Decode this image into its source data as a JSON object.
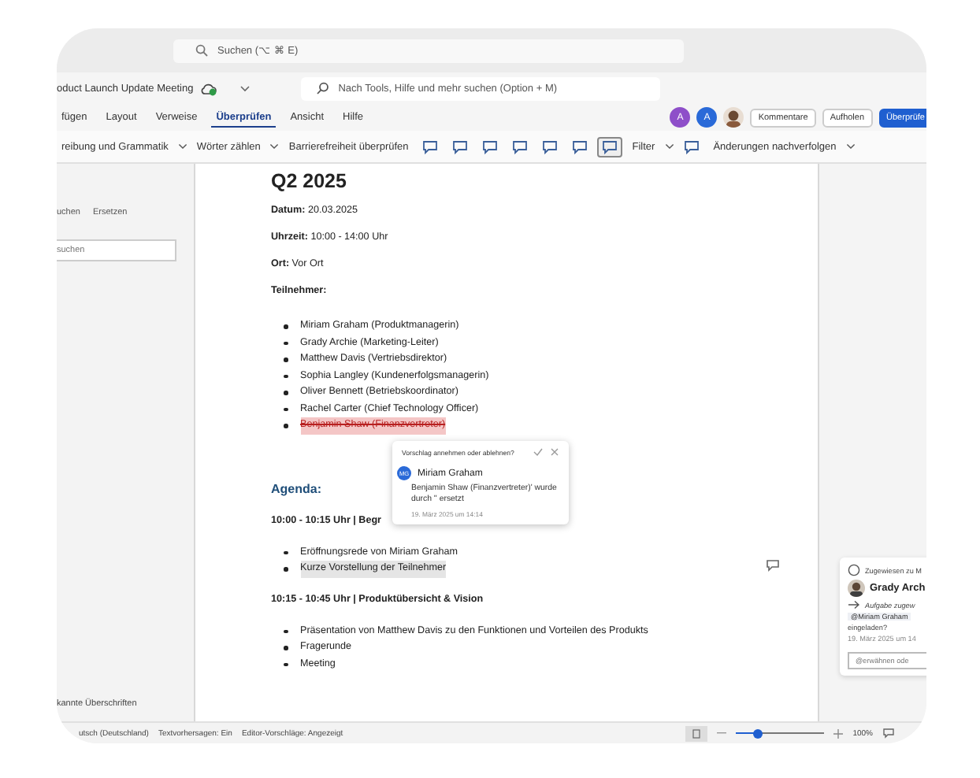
{
  "search": {
    "placeholder": "Suchen (⌥ ⌘ E)"
  },
  "document_title": "oduct Launch Update Meeting",
  "tool_search": {
    "placeholder": "Nach Tools, Hilfe und mehr suchen (Option + M)"
  },
  "tabs": [
    {
      "label": "fügen",
      "selected": false
    },
    {
      "label": "Layout",
      "selected": false
    },
    {
      "label": "Verweise",
      "selected": false
    },
    {
      "label": "Überprüfen",
      "selected": true
    },
    {
      "label": "Ansicht",
      "selected": false
    },
    {
      "label": "Hilfe",
      "selected": false
    }
  ],
  "avatars": [
    {
      "kind": "initials",
      "initials": "A",
      "color": "#8e4fc9"
    },
    {
      "kind": "initials",
      "initials": "A",
      "color": "#2a6ad8"
    },
    {
      "kind": "picture"
    }
  ],
  "header_buttons": [
    {
      "label": "Kommentare",
      "kind": "outline"
    },
    {
      "label": "Aufholen",
      "kind": "outline"
    },
    {
      "label": "Überprüfe",
      "kind": "primary"
    }
  ],
  "toolbar": [
    {
      "kind": "dropdown",
      "label": "reibung und Grammatik"
    },
    {
      "kind": "dropdown",
      "label": "Wörter zählen"
    },
    {
      "kind": "button",
      "label": "Barrierefreiheit überprüfen"
    },
    {
      "kind": "icon",
      "selected": false
    },
    {
      "kind": "icon",
      "selected": false
    },
    {
      "kind": "icon",
      "selected": false
    },
    {
      "kind": "icon",
      "selected": false
    },
    {
      "kind": "icon",
      "selected": false
    },
    {
      "kind": "icon",
      "selected": false
    },
    {
      "kind": "icon",
      "selected": true
    },
    {
      "kind": "dropdown",
      "label": "Filter"
    },
    {
      "kind": "icon",
      "selected": false
    },
    {
      "kind": "dropdown",
      "label": "Änderungen nachverfolgen"
    }
  ],
  "nav_pane": {
    "tabs": [
      "uchen",
      "Ersetzen"
    ],
    "search": {
      "placeholder": "suchen"
    },
    "footer": "kannte Überschriften"
  },
  "document": {
    "heading": "Q2 2025",
    "fields": [
      {
        "label": "Datum:",
        "value": "20.03.2025"
      },
      {
        "label": "Uhrzeit:",
        "value": "10:00 - 14:00 Uhr"
      },
      {
        "label": "Ort:",
        "value": "Vor Ort"
      }
    ],
    "attendees_label": "Teilnehmer:",
    "attendees": [
      {
        "text": "Miriam Graham (Produktmanagerin)",
        "deleted": false
      },
      {
        "text": "Grady Archie (Marketing-Leiter)",
        "deleted": false
      },
      {
        "text": "Matthew Davis (Vertriebsdirektor)",
        "deleted": false
      },
      {
        "text": "Sophia Langley (Kundenerfolgsmanagerin)",
        "deleted": false
      },
      {
        "text": "Oliver Bennett (Betriebskoordinator)",
        "deleted": false
      },
      {
        "text": "Rachel Carter (Chief Technology Officer)",
        "deleted": false
      },
      {
        "text": "Benjamin Shaw (Finanzvertreter)",
        "deleted": true
      }
    ],
    "agenda_heading": "Agenda:",
    "sections": [
      {
        "title": "10:00 - 10:15 Uhr | Begr",
        "items": [
          {
            "text": "Eröffnungsrede von Miriam Graham",
            "highlighted": false
          },
          {
            "text": "Kurze Vorstellung der Teilnehmer",
            "highlighted": true
          }
        ]
      },
      {
        "title": "10:15 - 10:45 Uhr | Produktübersicht & Vision",
        "items": [
          {
            "text": "Präsentation von Matthew Davis zu den Funktionen und Vorteilen des Produkts",
            "highlighted": false
          },
          {
            "text": "Fragerunde",
            "highlighted": false
          },
          {
            "text": "Meeting",
            "highlighted": false
          }
        ]
      }
    ]
  },
  "suggestion_popup": {
    "question": "Vorschlag annehmen oder ablehnen?",
    "author_initials": "MG",
    "author": "Miriam Graham",
    "text": "Benjamin Shaw (Finanzvertreter)' wurde durch '' ersetzt",
    "time": "19. März 2025 um 14:14"
  },
  "comment_card": {
    "assigned": "Zugewiesen zu M",
    "author": "Grady Arch",
    "task": "Aufgabe zugew",
    "mention": "@Miriam Graham",
    "text": "eingeladen?",
    "time": "19. März 2025 um 14",
    "reply": {
      "placeholder": "@erwähnen ode"
    }
  },
  "status_bar": {
    "items": [
      "utsch (Deutschland)",
      "Textvorhersagen: Ein",
      "Editor-Vorschläge: Angezeigt"
    ],
    "zoom": {
      "level": 0.25,
      "label": "100%"
    }
  }
}
